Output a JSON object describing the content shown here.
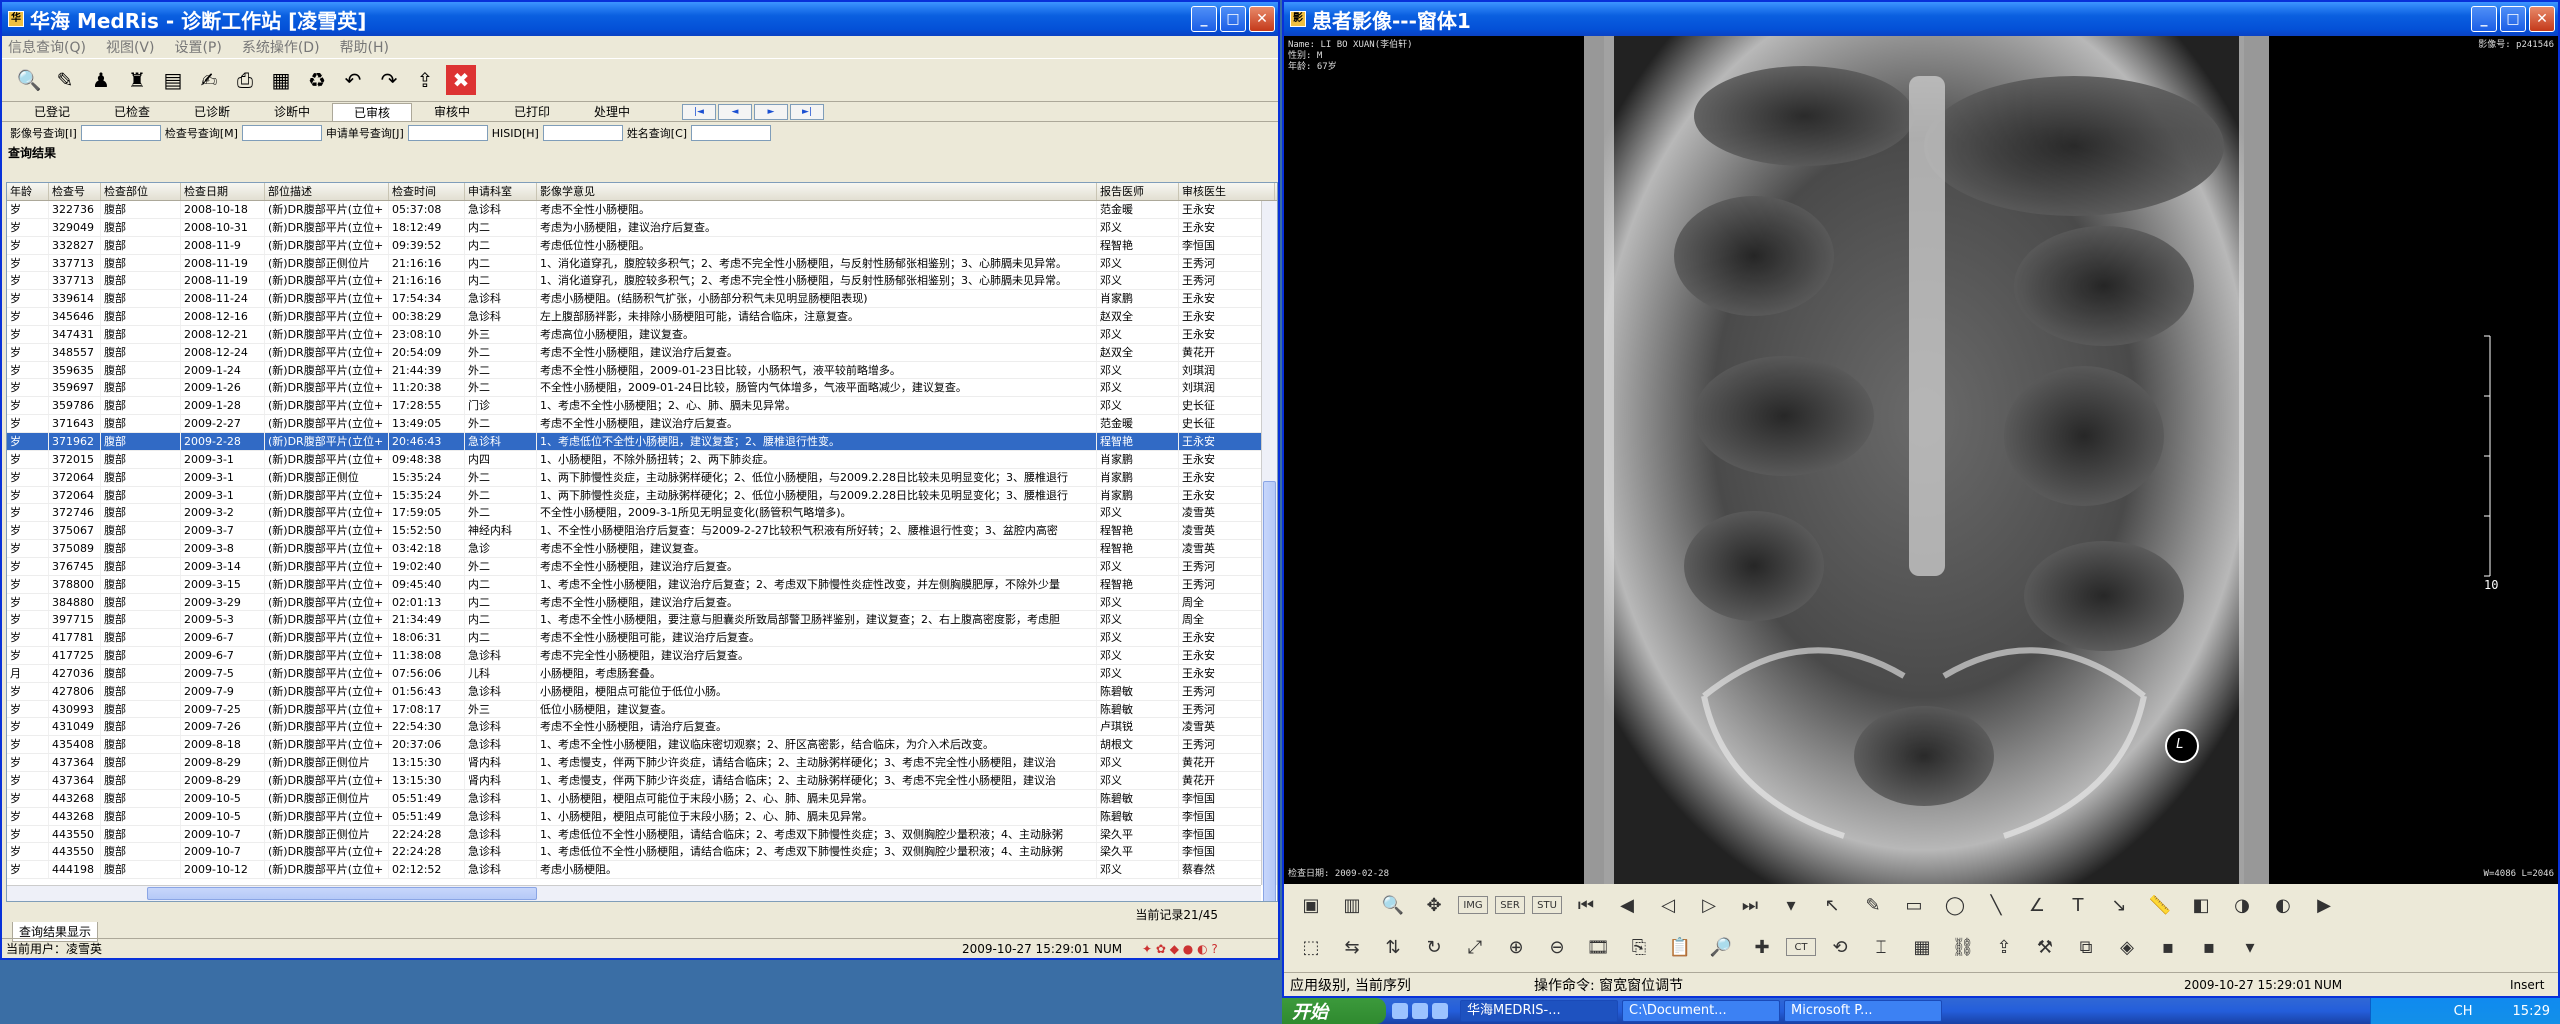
{
  "main_window": {
    "title": "华海 MedRis - 诊断工作站 [凌雪英]",
    "menu": [
      "信息查询(Q)",
      "视图(V)",
      "设置(P)",
      "系统操作(D)",
      "帮助(H)"
    ],
    "toolbar_icons": [
      "search-icon",
      "edit-icon",
      "person-icon",
      "group-icon",
      "document-icon",
      "signature-icon",
      "print-icon",
      "excel-icon",
      "recycle-icon",
      "undo-icon",
      "redo-icon",
      "export-icon",
      "close-icon"
    ],
    "tabs": [
      "已登记",
      "已检查",
      "已诊断",
      "诊断中",
      "已审核",
      "审核中",
      "已打印",
      "处理中"
    ],
    "active_tab": 4,
    "nav_buttons": [
      "|◄",
      "◄",
      "►",
      "►|"
    ],
    "query": [
      {
        "label": "影像号查询[I]",
        "value": ""
      },
      {
        "label": "检查号查询[M]",
        "value": ""
      },
      {
        "label": "申请单号查询[J]",
        "value": ""
      },
      {
        "label": "HISID[H]",
        "value": ""
      },
      {
        "label": "姓名查询[C]",
        "value": ""
      }
    ],
    "section_title": "查询结果",
    "columns": [
      "年龄",
      "检查号",
      "检查部位",
      "检查日期",
      "部位描述",
      "检查时间",
      "申请科室",
      "影像学意见",
      "报告医师",
      "审核医生"
    ],
    "rows": [
      [
        "岁",
        "322736",
        "腹部",
        "2008-10-18",
        "(新)DR腹部平片(立位+",
        "05:37:08",
        "急诊科",
        "考虑不全性小肠梗阻。",
        "范金暖",
        "王永安"
      ],
      [
        "岁",
        "329049",
        "腹部",
        "2008-10-31",
        "(新)DR腹部平片(立位+",
        "18:12:49",
        "内二",
        "考虑为小肠梗阻，建议治疗后复查。",
        "邓义",
        "王永安"
      ],
      [
        "岁",
        "332827",
        "腹部",
        "2008-11-9",
        "(新)DR腹部平片(立位+",
        "09:39:52",
        "内二",
        "考虑低位性小肠梗阻。",
        "程智艳",
        "李恒国"
      ],
      [
        "岁",
        "337713",
        "腹部",
        "2008-11-19",
        "(新)DR腹部正侧位片",
        "21:16:16",
        "内二",
        "1、消化道穿孔，腹腔较多积气；2、考虑不完全性小肠梗阻，与反射性肠郁张相鉴别；3、心肺膈未见异常。",
        "邓义",
        "王秀河"
      ],
      [
        "岁",
        "337713",
        "腹部",
        "2008-11-19",
        "(新)DR腹部平片(立位+",
        "21:16:16",
        "内二",
        "1、消化道穿孔，腹腔较多积气；2、考虑不完全性小肠梗阻，与反射性肠郁张相鉴别；3、心肺膈未见异常。",
        "邓义",
        "王秀河"
      ],
      [
        "岁",
        "339614",
        "腹部",
        "2008-11-24",
        "(新)DR腹部平片(立位+",
        "17:54:34",
        "急诊科",
        "考虑小肠梗阻。(结肠积气扩张，小肠部分积气未见明显肠梗阻表现)",
        "肖家鹏",
        "王永安"
      ],
      [
        "岁",
        "345646",
        "腹部",
        "2008-12-16",
        "(新)DR腹部平片(立位+",
        "00:38:29",
        "急诊科",
        "左上腹部肠袢影，未排除小肠梗阻可能，请结合临床，注意复查。",
        "赵双全",
        "王永安"
      ],
      [
        "岁",
        "347431",
        "腹部",
        "2008-12-21",
        "(新)DR腹部平片(立位+",
        "23:08:10",
        "外三",
        "考虑高位小肠梗阻，建议复查。",
        "邓义",
        "王永安"
      ],
      [
        "岁",
        "348557",
        "腹部",
        "2008-12-24",
        "(新)DR腹部平片(立位+",
        "20:54:09",
        "外二",
        "考虑不全性小肠梗阻，建议治疗后复查。",
        "赵双全",
        "黄花开"
      ],
      [
        "岁",
        "359635",
        "腹部",
        "2009-1-24",
        "(新)DR腹部平片(立位+",
        "21:44:39",
        "外二",
        "考虑不全性小肠梗阻，2009-01-23日比较，小肠积气，液平较前略增多。",
        "邓义",
        "刘琪润"
      ],
      [
        "岁",
        "359697",
        "腹部",
        "2009-1-26",
        "(新)DR腹部平片(立位+",
        "11:20:38",
        "外二",
        "不全性小肠梗阻，2009-01-24日比较，肠管内气体增多，气液平面略减少，建议复查。",
        "邓义",
        "刘琪润"
      ],
      [
        "岁",
        "359786",
        "腹部",
        "2009-1-28",
        "(新)DR腹部平片(立位+",
        "17:28:55",
        "门诊",
        "1、考虑不全性小肠梗阻；2、心、肺、膈未见异常。",
        "邓义",
        "史长征"
      ],
      [
        "岁",
        "371643",
        "腹部",
        "2009-2-27",
        "(新)DR腹部平片(立位+",
        "13:49:05",
        "外二",
        "考虑不全性小肠梗阻，建议治疗后复查。",
        "范金暖",
        "史长征"
      ],
      [
        "岁",
        "371962",
        "腹部",
        "2009-2-28",
        "(新)DR腹部平片(立位+",
        "20:46:43",
        "急诊科",
        "1、考虑低位不全性小肠梗阻，建议复查；2、腰椎退行性变。",
        "程智艳",
        "王永安"
      ],
      [
        "岁",
        "372015",
        "腹部",
        "2009-3-1",
        "(新)DR腹部平片(立位+",
        "09:48:38",
        "内四",
        "1、小肠梗阻，不除外肠扭转；2、两下肺炎症。",
        "肖家鹏",
        "王永安"
      ],
      [
        "岁",
        "372064",
        "腹部",
        "2009-3-1",
        "(新)DR腹部正侧位",
        "15:35:24",
        "外二",
        "1、两下肺慢性炎症，主动脉粥样硬化；2、低位小肠梗阻，与2009.2.28日比较未见明显变化；3、腰椎退行",
        "肖家鹏",
        "王永安"
      ],
      [
        "岁",
        "372064",
        "腹部",
        "2009-3-1",
        "(新)DR腹部平片(立位+",
        "15:35:24",
        "外二",
        "1、两下肺慢性炎症，主动脉粥样硬化；2、低位小肠梗阻，与2009.2.28日比较未见明显变化；3、腰椎退行",
        "肖家鹏",
        "王永安"
      ],
      [
        "岁",
        "372746",
        "腹部",
        "2009-3-2",
        "(新)DR腹部平片(立位+",
        "17:59:05",
        "外二",
        "不全性小肠梗阻，2009-3-1所见无明显变化(肠管积气略增多)。",
        "邓义",
        "凌雪英"
      ],
      [
        "岁",
        "375067",
        "腹部",
        "2009-3-7",
        "(新)DR腹部平片(立位+",
        "15:52:50",
        "神经内科",
        "1、不全性小肠梗阻治疗后复查：与2009-2-27比较积气积液有所好转；2、腰椎退行性变；3、盆腔内高密",
        "程智艳",
        "凌雪英"
      ],
      [
        "岁",
        "375089",
        "腹部",
        "2009-3-8",
        "(新)DR腹部平片(立位+",
        "03:42:18",
        "急诊",
        "考虑不全性小肠梗阻，建议复查。",
        "程智艳",
        "凌雪英"
      ],
      [
        "岁",
        "376745",
        "腹部",
        "2009-3-14",
        "(新)DR腹部平片(立位+",
        "19:02:40",
        "外二",
        "考虑不全性小肠梗阻，建议治疗后复查。",
        "邓义",
        "王秀河"
      ],
      [
        "岁",
        "378800",
        "腹部",
        "2009-3-15",
        "(新)DR腹部平片(立位+",
        "09:45:40",
        "内二",
        "1、考虑不全性小肠梗阻，建议治疗后复查；2、考虑双下肺慢性炎症性改变，并左侧胸膜肥厚，不除外少量",
        "程智艳",
        "王秀河"
      ],
      [
        "岁",
        "384880",
        "腹部",
        "2009-3-29",
        "(新)DR腹部平片(立位+",
        "02:01:13",
        "内二",
        "考虑不全性小肠梗阻，建议治疗后复查。",
        "邓义",
        "周全"
      ],
      [
        "岁",
        "397715",
        "腹部",
        "2009-5-3",
        "(新)DR腹部平片(立位+",
        "21:34:49",
        "内二",
        "1、考虑不全性小肠梗阻，要注意与胆囊炎所致局部警卫肠袢鉴别，建议复查；2、右上腹高密度影，考虑胆",
        "邓义",
        "周全"
      ],
      [
        "岁",
        "417781",
        "腹部",
        "2009-6-7",
        "(新)DR腹部平片(立位+",
        "18:06:31",
        "内二",
        "考虑不全性小肠梗阻可能，建议治疗后复查。",
        "邓义",
        "王永安"
      ],
      [
        "岁",
        "417725",
        "腹部",
        "2009-6-7",
        "(新)DR腹部平片(立位+",
        "11:38:08",
        "急诊科",
        "考虑不完全性小肠梗阻，建议治疗后复查。",
        "邓义",
        "王永安"
      ],
      [
        "月",
        "427036",
        "腹部",
        "2009-7-5",
        "(新)DR腹部平片(立位+",
        "07:56:06",
        "儿科",
        "小肠梗阻，考虑肠套叠。",
        "邓义",
        "王永安"
      ],
      [
        "岁",
        "427806",
        "腹部",
        "2009-7-9",
        "(新)DR腹部平片(立位+",
        "01:56:43",
        "急诊科",
        "小肠梗阻，梗阻点可能位于低位小肠。",
        "陈碧敏",
        "王秀河"
      ],
      [
        "岁",
        "430993",
        "腹部",
        "2009-7-25",
        "(新)DR腹部平片(立位+",
        "17:08:17",
        "外三",
        "低位小肠梗阻，建议复查。",
        "陈碧敏",
        "王秀河"
      ],
      [
        "岁",
        "431049",
        "腹部",
        "2009-7-26",
        "(新)DR腹部平片(立位+",
        "22:54:30",
        "急诊科",
        "考虑不全性小肠梗阻，请治疗后复查。",
        "卢琪锐",
        "凌雪英"
      ],
      [
        "岁",
        "435408",
        "腹部",
        "2009-8-18",
        "(新)DR腹部平片(立位+",
        "20:37:06",
        "急诊科",
        "1、考虑不全性小肠梗阻，建议临床密切观察；2、肝区高密影，结合临床，为介入术后改变。",
        "胡根文",
        "王秀河"
      ],
      [
        "岁",
        "437364",
        "腹部",
        "2009-8-29",
        "(新)DR腹部正侧位片",
        "13:15:30",
        "肾内科",
        "1、考虑慢支，伴两下肺少许炎症，请结合临床；2、主动脉粥样硬化；3、考虑不完全性小肠梗阻，建议治",
        "邓义",
        "黄花开"
      ],
      [
        "岁",
        "437364",
        "腹部",
        "2009-8-29",
        "(新)DR腹部平片(立位+",
        "13:15:30",
        "肾内科",
        "1、考虑慢支，伴两下肺少许炎症，请结合临床；2、主动脉粥样硬化；3、考虑不完全性小肠梗阻，建议治",
        "邓义",
        "黄花开"
      ],
      [
        "岁",
        "443268",
        "腹部",
        "2009-10-5",
        "(新)DR腹部正侧位片",
        "05:51:49",
        "急诊科",
        "1、小肠梗阻，梗阻点可能位于末段小肠；2、心、肺、膈未见异常。",
        "陈碧敏",
        "李恒国"
      ],
      [
        "岁",
        "443268",
        "腹部",
        "2009-10-5",
        "(新)DR腹部平片(立位+",
        "05:51:49",
        "急诊科",
        "1、小肠梗阻，梗阻点可能位于末段小肠；2、心、肺、膈未见异常。",
        "陈碧敏",
        "李恒国"
      ],
      [
        "岁",
        "443550",
        "腹部",
        "2009-10-7",
        "(新)DR腹部正侧位片",
        "22:24:28",
        "急诊科",
        "1、考虑低位不全性小肠梗阻，请结合临床；2、考虑双下肺慢性炎症；3、双侧胸腔少量积液；4、主动脉粥",
        "梁久平",
        "李恒国"
      ],
      [
        "岁",
        "443550",
        "腹部",
        "2009-10-7",
        "(新)DR腹部平片(立位+",
        "22:24:28",
        "急诊科",
        "1、考虑低位不全性小肠梗阻，请结合临床；2、考虑双下肺慢性炎症；3、双侧胸腔少量积液；4、主动脉粥",
        "梁久平",
        "李恒国"
      ],
      [
        "岁",
        "444198",
        "腹部",
        "2009-10-12",
        "(新)DR腹部平片(立位+",
        "02:12:52",
        "急诊科",
        "考虑小肠梗阻。",
        "邓义",
        "蔡春然"
      ]
    ],
    "selected_row": 13,
    "record_info": "当前记录21/45",
    "bottom_tab": "查询结果显示",
    "status_user": "当前用户：凌雪英",
    "status_time": "2009-10-27 15:29:01",
    "status_num": "NUM"
  },
  "viewer_window": {
    "title": "患者影像---窗体1",
    "overlay_tl": [
      "Name: LI BO XUAN(李伯轩)",
      "性别: M",
      "年龄: 67岁"
    ],
    "overlay_tr": "影像号: p241546",
    "overlay_bl": "检查日期: 2009-02-28",
    "overlay_br": "W=4086 L=2046",
    "scale_label": "10",
    "marker": "L",
    "tool_icons_row1": [
      "window-icon",
      "layout-icon",
      "zoom-icon",
      "pan-icon",
      "IMG",
      "SER",
      "STU",
      "first-icon",
      "prev-icon",
      "prev-page-icon",
      "next-page-icon",
      "last-icon",
      "more-icon",
      "pointer-icon",
      "pen-icon",
      "rect-icon",
      "ellipse-icon",
      "line-icon",
      "angle-icon",
      "text-icon",
      "arrow-icon",
      "ruler-icon",
      "invert-icon",
      "contrast-icon",
      "window-level-icon",
      "cine-icon"
    ],
    "tool_icons_row2": [
      "select-icon",
      "flip-h-icon",
      "flip-v-icon",
      "rotate-icon",
      "fit-icon",
      "zoom-in-icon",
      "zoom-out-icon",
      "film-icon",
      "copy-icon",
      "paste-icon",
      "magnifier-icon",
      "cross-icon",
      "CT",
      "reset-icon",
      "spine-icon",
      "grid-icon",
      "link-icon",
      "export-icon",
      "tools-icon",
      "compare-icon",
      "3d-icon",
      "CT-icon",
      "CT-2-icon",
      "more-icon"
    ],
    "status_level": "应用级别, 当前序列",
    "status_op": "操作命令: 窗宽窗位调节",
    "status_time": "2009-10-27 15:29:01",
    "status_num": "NUM",
    "status_insert": "Insert"
  },
  "taskbar": {
    "start": "开始",
    "items": [
      "华海MEDRIS-...",
      "C:\\Document...",
      "Microsoft P..."
    ],
    "tray_lang": "CH",
    "clock": "15:29"
  }
}
